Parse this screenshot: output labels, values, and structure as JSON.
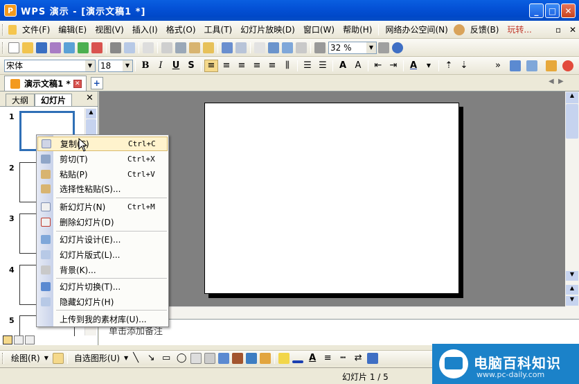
{
  "window": {
    "title": "WPS 演示 - [演示文稿1 *]",
    "icon_label": "P",
    "minimize": "_",
    "maximize": "□",
    "close": "✕"
  },
  "menubar": {
    "items": [
      "文件(F)",
      "编辑(E)",
      "视图(V)",
      "插入(I)",
      "格式(O)",
      "工具(T)",
      "幻灯片放映(D)",
      "窗口(W)",
      "帮助(H)",
      "网络办公空间(N)",
      "反馈(B)",
      "玩转..."
    ],
    "restore": "▫",
    "close": "✕"
  },
  "standard_toolbar": {
    "zoom": "32 %"
  },
  "format_toolbar": {
    "font": "宋体",
    "size": "18",
    "bold": "B",
    "italic": "I",
    "underline": "U",
    "shadow": "S"
  },
  "document_tab": {
    "label": "演示文稿1 *",
    "new_tab": "+"
  },
  "left_panel": {
    "tabs": [
      "大纲",
      "幻灯片"
    ],
    "close": "✕",
    "slides": [
      "1",
      "2",
      "3",
      "4",
      "5"
    ]
  },
  "context_menu": {
    "items": [
      {
        "label": "复制(C)",
        "shortcut": "Ctrl+C"
      },
      {
        "label": "剪切(T)",
        "shortcut": "Ctrl+X"
      },
      {
        "label": "粘贴(P)",
        "shortcut": "Ctrl+V"
      },
      {
        "label": "选择性粘贴(S)...",
        "shortcut": ""
      },
      {
        "label": "新幻灯片(N)",
        "shortcut": "Ctrl+M"
      },
      {
        "label": "删除幻灯片(D)",
        "shortcut": ""
      },
      {
        "label": "幻灯片设计(E)...",
        "shortcut": ""
      },
      {
        "label": "幻灯片版式(L)...",
        "shortcut": ""
      },
      {
        "label": "背景(K)...",
        "shortcut": ""
      },
      {
        "label": "幻灯片切换(T)...",
        "shortcut": ""
      },
      {
        "label": "隐藏幻灯片(H)",
        "shortcut": ""
      },
      {
        "label": "上传到我的素材库(U)...",
        "shortcut": ""
      }
    ]
  },
  "notes": {
    "placeholder": "单击添加备注"
  },
  "drawing_toolbar": {
    "draw": "绘图(R)",
    "autoshapes": "自选图形(U)"
  },
  "statusbar": {
    "slide_info": "幻灯片 1 / 5"
  },
  "watermark": {
    "title": "电脑百科知识",
    "url": "www.pc-daily.com"
  },
  "colors": {
    "titlebar": "#0451d6",
    "accent": "#f39a1e",
    "highlight": "#fff3cd",
    "canvas": "#808080"
  }
}
